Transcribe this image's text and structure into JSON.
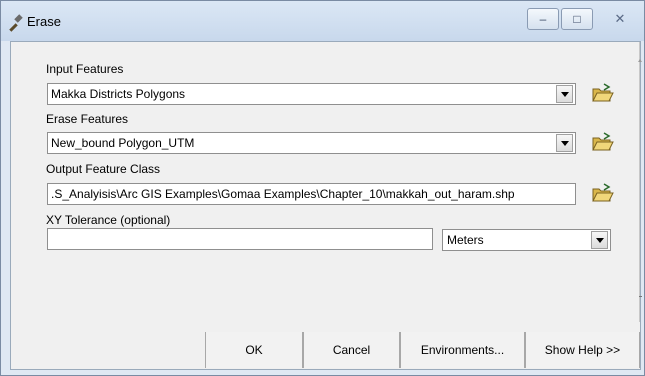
{
  "window": {
    "title": "Erase",
    "minimize_glyph": "–",
    "maximize_glyph": "□",
    "close_glyph": "✕"
  },
  "form": {
    "input_features": {
      "label": "Input Features",
      "value": "Makka Districts Polygons"
    },
    "erase_features": {
      "label": "Erase Features",
      "value": "New_bound Polygon_UTM"
    },
    "output_feature_class": {
      "label": "Output Feature Class",
      "value": ".S_Analyisis\\Arc GIS Examples\\Gomaa Examples\\Chapter_10\\makkah_out_haram.shp"
    },
    "xy_tolerance": {
      "label": "XY Tolerance (optional)",
      "value": "",
      "unit": "Meters"
    }
  },
  "buttons": {
    "ok": "OK",
    "cancel": "Cancel",
    "environments": "Environments...",
    "show_help": "Show Help >>"
  },
  "icons": {
    "title": "hammer-icon",
    "browse": "open-folder-icon",
    "dropdown": "chevron-down-icon"
  }
}
